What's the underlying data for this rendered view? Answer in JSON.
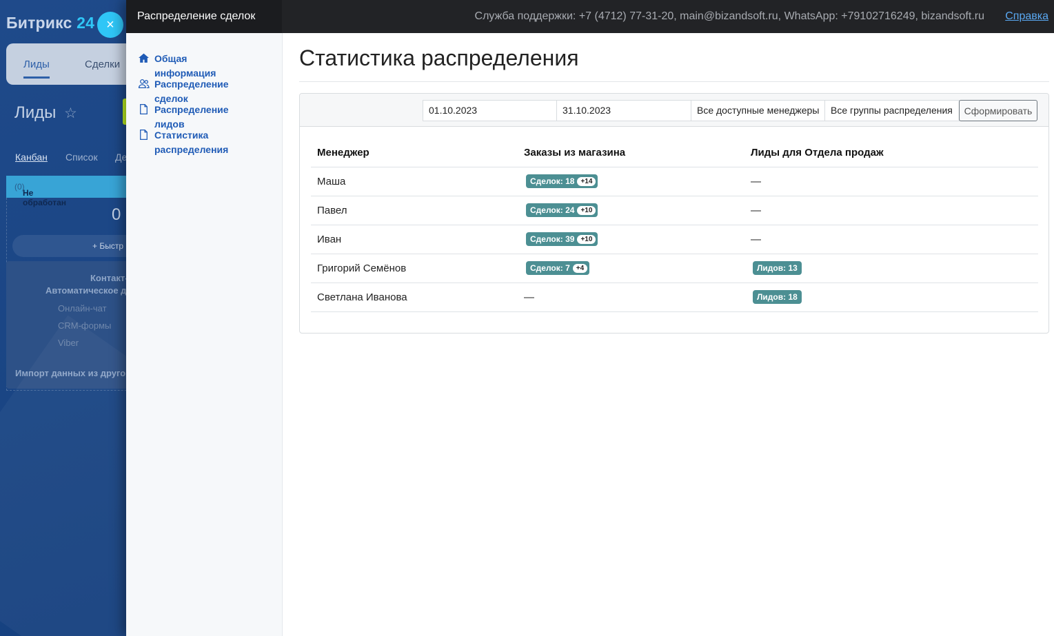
{
  "background": {
    "logo_main": "Битрикс",
    "logo_num": "24",
    "close_icon": "×",
    "tabs": [
      "Лиды",
      "Сделки"
    ],
    "page_title": "Лиды",
    "star_icon": "☆",
    "views": [
      "Канбан",
      "Список",
      "Де"
    ],
    "column_name": "Не обработан",
    "column_count": "(0)",
    "column_total": "0",
    "quick_add": "+ Быстр",
    "card_line1": "Контакт-",
    "card_line2": "Автоматическое до",
    "channels": [
      "Онлайн-чат",
      "CRM-формы",
      "Viber"
    ],
    "import_text": "Импорт данных из другой"
  },
  "header": {
    "app_title": "Распределение сделок",
    "support_text": "Служба поддержки: +7 (4712) 77-31-20, main@bizandsoft.ru, WhatsApp: +79102716249, bizandsoft.ru",
    "help_link": "Справка"
  },
  "nav": {
    "items": [
      {
        "label": "Общая информация",
        "icon": "home-icon"
      },
      {
        "label": "Распределение сделок",
        "icon": "users-icon"
      },
      {
        "label": "Распределение лидов",
        "icon": "document-icon"
      },
      {
        "label": "Статистика распределения",
        "icon": "document-icon"
      }
    ]
  },
  "main": {
    "title": "Статистика распределения",
    "filters": {
      "date_from": "01.10.2023",
      "date_to": "31.10.2023",
      "managers": "Все доступные менеджеры",
      "groups": "Все группы распределения",
      "submit": "Сформировать"
    },
    "table": {
      "headers": [
        "Менеджер",
        "Заказы из магазина",
        "Лиды для Отдела продаж"
      ],
      "rows": [
        {
          "manager": "Маша",
          "orders": "Сделок: 18",
          "orders_plus": "+14",
          "leads": "—"
        },
        {
          "manager": "Павел",
          "orders": "Сделок: 24",
          "orders_plus": "+10",
          "leads": "—"
        },
        {
          "manager": "Иван",
          "orders": "Сделок: 39",
          "orders_plus": "+10",
          "leads": "—"
        },
        {
          "manager": "Григорий Семёнов",
          "orders": "Сделок: 7",
          "orders_plus": "+4",
          "leads": "Лидов: 13"
        },
        {
          "manager": "Светлана Иванова",
          "orders": "—",
          "orders_plus": "",
          "leads": "Лидов: 18"
        }
      ]
    }
  }
}
